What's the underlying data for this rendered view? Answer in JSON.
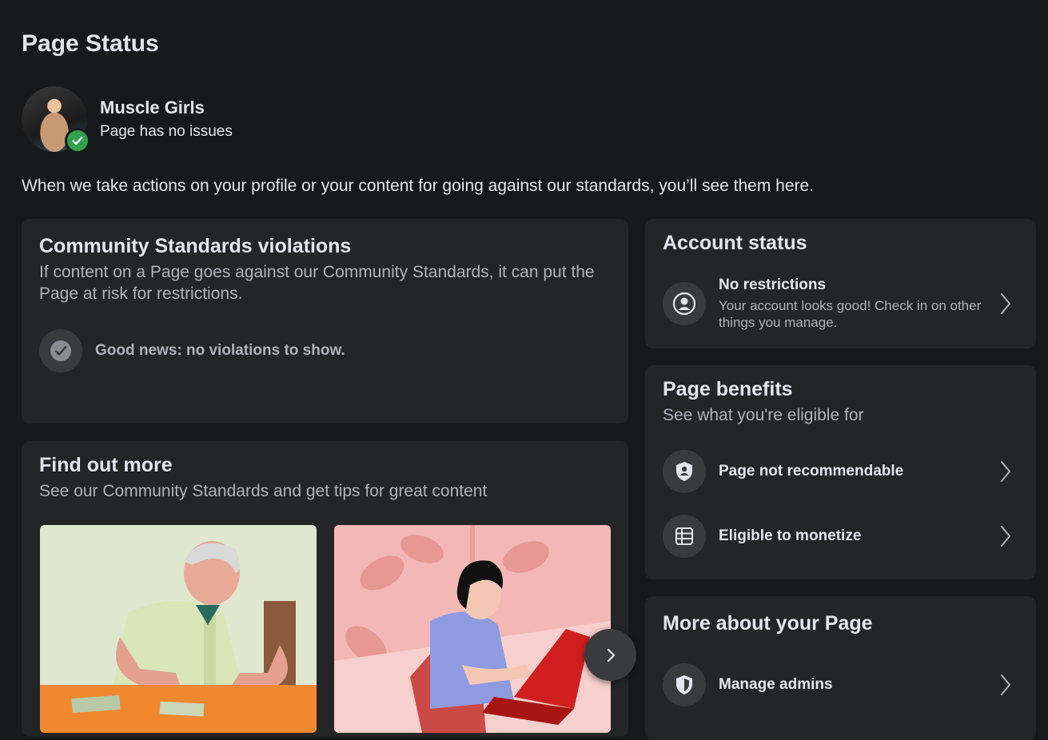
{
  "page": {
    "title": "Page Status",
    "intro": "When we take actions on your profile or your content for going against our standards, you’ll see them here."
  },
  "profile": {
    "name": "Muscle Girls",
    "status": "Page has no issues"
  },
  "violations": {
    "title": "Community Standards violations",
    "subtitle": "If content on a Page goes against our Community Standards, it can put the Page at risk for restrictions.",
    "good_news": "Good news: no violations to show."
  },
  "find_out_more": {
    "title": "Find out more",
    "subtitle": "See our Community Standards and get tips for great content"
  },
  "account_status": {
    "title": "Account status",
    "item_label": "No restrictions",
    "item_desc": "Your account looks good! Check in on other things you manage."
  },
  "page_benefits": {
    "title": "Page benefits",
    "subtitle": "See what you're eligible for",
    "items": [
      {
        "label": "Page not recommendable"
      },
      {
        "label": "Eligible to monetize"
      }
    ]
  },
  "more_about": {
    "title": "More about your Page",
    "items": [
      {
        "label": "Manage admins"
      }
    ]
  },
  "colors": {
    "background": "#18191a",
    "card": "#242526",
    "success_green": "#31a24c",
    "icon_circle": "#3a3b3c"
  }
}
